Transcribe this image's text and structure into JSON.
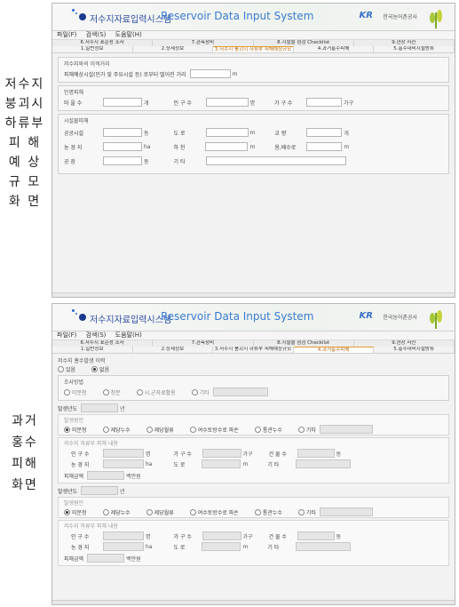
{
  "side_labels": {
    "top": [
      "저수지",
      "붕괴시",
      "하류부",
      "피 해",
      "예 상",
      "규 모",
      "화 면"
    ],
    "bottom": [
      "과거",
      "홍수",
      "피해",
      "화면"
    ]
  },
  "app": {
    "title_ko": "저수지자료입력시스템",
    "title_en": "Reservoir Data Input System",
    "org_mark": "KR",
    "org": "한국농어촌공사"
  },
  "menu": [
    "파일(F)",
    "검색(S)",
    "도움말(H)"
  ],
  "tabs_back": [
    "6.저수지 표준성 조사",
    "7.관측장비",
    "8.시설물 점검 Checklist",
    "9.현장 사진"
  ],
  "tabs_front": [
    "1.일반정보",
    "2.상세정보",
    "3.저수지 붕괴시 하류부 피해예상규모",
    "4.과거홍수피해",
    "5.홍수대비시설방류"
  ],
  "screen1": {
    "active_tab": 2,
    "distance_group": {
      "title": "저수지와의 이격거리",
      "label": "피해예상시설(민가 및 주요시설 등) 로부터 떨어진 거리",
      "unit": "m"
    },
    "human_group": {
      "title": "인명피해",
      "fields": [
        {
          "label": "마 을 수",
          "unit": "개"
        },
        {
          "label": "인 구 수",
          "unit": "명"
        },
        {
          "label": "가 구 수",
          "unit": "가구"
        }
      ]
    },
    "facility_group": {
      "title": "시설물피해",
      "rows": [
        [
          {
            "label": "공공시설",
            "unit": "동"
          },
          {
            "label": "도 로",
            "unit": "m"
          },
          {
            "label": "교 량",
            "unit": "개"
          }
        ],
        [
          {
            "label": "농 경 지",
            "unit": "ha"
          },
          {
            "label": "하 천",
            "unit": "m"
          },
          {
            "label": "용,배수로",
            "unit": "m"
          }
        ],
        [
          {
            "label": "공 장",
            "unit": "동"
          },
          {
            "label": "기 타",
            "unit": ""
          }
        ]
      ]
    }
  },
  "screen2": {
    "active_tab": 3,
    "occurrence": {
      "title": "저수지 홍수발생 이력",
      "options": [
        "있음",
        "없음"
      ]
    },
    "survey": {
      "title": "조사방법",
      "options": [
        "미분청",
        "청문",
        "시,군자료활용",
        "기타"
      ]
    },
    "records": [
      {
        "year_label": "발생년도",
        "year_unit": "년",
        "cause_title": "발생원인",
        "causes": [
          "미분청",
          "제당누수",
          "제당월류",
          "여수토방수로 파손",
          "통관누수",
          "기타"
        ],
        "damage_title": "저수지 하류부 피해 내용",
        "row1": [
          {
            "label": "인 구 수",
            "unit": "명"
          },
          {
            "label": "가 구 수",
            "unit": "가구"
          },
          {
            "label": "건 물 수",
            "unit": "동"
          }
        ],
        "row2": [
          {
            "label": "농 경 지",
            "unit": "ha"
          },
          {
            "label": "도 로",
            "unit": "m"
          },
          {
            "label": "기 타",
            "unit": ""
          }
        ],
        "amount_label": "피해금액",
        "amount_unit": "백만원"
      },
      {
        "year_label": "발생년도",
        "year_unit": "년",
        "cause_title": "발생원인",
        "causes": [
          "미분청",
          "제당누수",
          "제당월류",
          "여수토방수로 파손",
          "통관누수",
          "기타"
        ],
        "damage_title": "저수지 하류부 피해 내용",
        "row1": [
          {
            "label": "인 구 수",
            "unit": "명"
          },
          {
            "label": "가 구 수",
            "unit": "가구"
          },
          {
            "label": "건 물 수",
            "unit": "동"
          }
        ],
        "row2": [
          {
            "label": "농 경 지",
            "unit": "ha"
          },
          {
            "label": "도 로",
            "unit": "m"
          },
          {
            "label": "기 타",
            "unit": ""
          }
        ],
        "amount_label": "피해금액",
        "amount_unit": "백만원"
      }
    ]
  }
}
